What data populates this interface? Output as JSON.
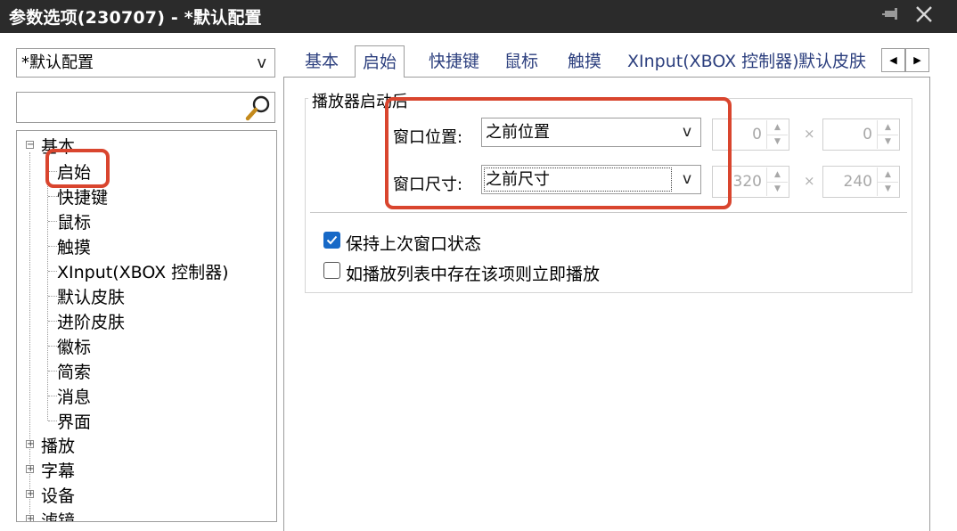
{
  "window": {
    "title": "参数选项(230707) - *默认配置",
    "pin_icon": "pin-icon",
    "close_icon": "close-icon"
  },
  "sidebar": {
    "profile_value": "*默认配置",
    "dropdown_chevron": "v",
    "search_icon": "search-icon",
    "tree": {
      "basic": {
        "expander": "−",
        "label": "基本"
      },
      "children": [
        "启始",
        "快捷键",
        "鼠标",
        "触摸",
        "XInput(XBOX 控制器)",
        "默认皮肤",
        "进阶皮肤",
        "徽标",
        "简索",
        "消息",
        "界面"
      ],
      "collapsed": [
        {
          "expander": "+",
          "label": "播放"
        },
        {
          "expander": "+",
          "label": "字幕"
        },
        {
          "expander": "+",
          "label": "设备"
        },
        {
          "expander": "+",
          "label": "滤镜"
        }
      ]
    }
  },
  "tabs": [
    "基本",
    "启始",
    "快捷键",
    "鼠标",
    "触摸",
    "XInput(XBOX 控制器)",
    "默认皮肤"
  ],
  "active_tab": "启始",
  "tab_scroll": {
    "left": "◀",
    "right": "▶"
  },
  "startup_group": {
    "caption": "播放器启动后",
    "window_position": {
      "label": "窗口位置:",
      "value": "之前位置",
      "chevron": "v",
      "x": "0",
      "y": "0",
      "times": "×"
    },
    "window_size": {
      "label": "窗口尺寸:",
      "value": "之前尺寸",
      "chevron": "v",
      "width": "320",
      "height": "240",
      "times": "×"
    },
    "spin_up": "▲",
    "spin_down": "▼",
    "options": [
      {
        "label": "保持上次窗口状态",
        "checked": true
      },
      {
        "label": "如播放列表中存在该项则立即播放",
        "checked": false
      }
    ]
  },
  "colors": {
    "titlebar": "#2b2b2b",
    "tab_text": "#2c3f7e",
    "highlight": "#d9452e",
    "checkbox_checked": "#1769c7"
  }
}
